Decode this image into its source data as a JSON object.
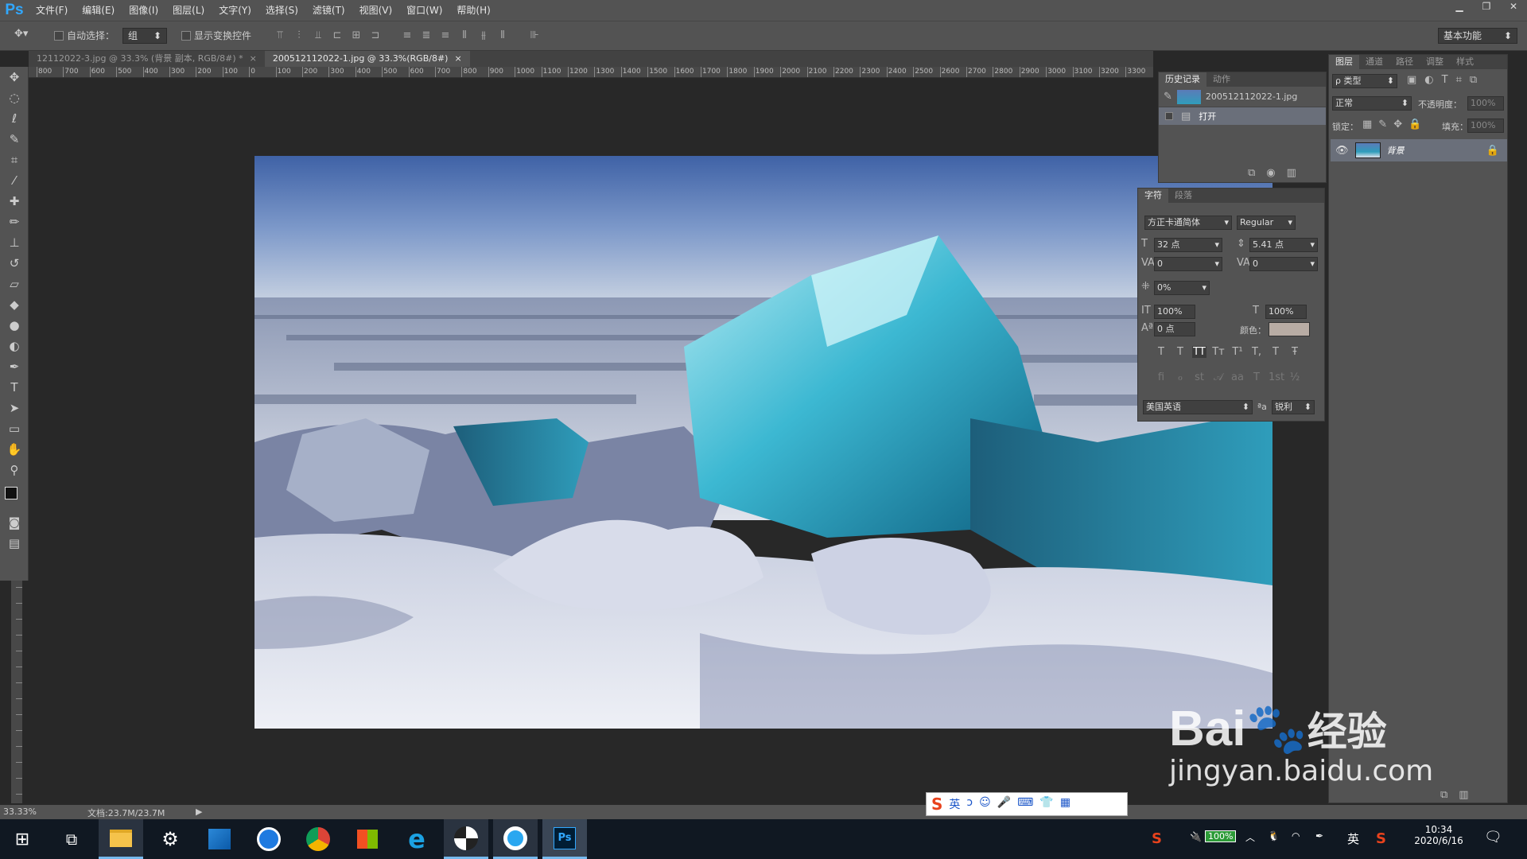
{
  "app": {
    "logo": "Ps"
  },
  "menu": [
    "文件(F)",
    "编辑(E)",
    "图像(I)",
    "图层(L)",
    "文字(Y)",
    "选择(S)",
    "滤镜(T)",
    "视图(V)",
    "窗口(W)",
    "帮助(H)"
  ],
  "window_controls": {
    "minimize": "▁",
    "restore": "❐",
    "close": "✕"
  },
  "options": {
    "auto_select_label": "自动选择：",
    "auto_select_value": "组",
    "show_transform_label": "显示变换控件",
    "workspace": "基本功能"
  },
  "tabs": [
    {
      "label": "12112022-3.jpg @ 33.3% (背景 副本, RGB/8#) *",
      "close": "×"
    },
    {
      "label": "200512112022-1.jpg @ 33.3%(RGB/8#)",
      "close": "×"
    }
  ],
  "ruler_h": [
    "800",
    "700",
    "600",
    "500",
    "400",
    "300",
    "200",
    "100",
    "0",
    "100",
    "200",
    "300",
    "400",
    "500",
    "600",
    "700",
    "800",
    "900",
    "1000",
    "1100",
    "1200",
    "1300",
    "1400",
    "1500",
    "1600",
    "1700",
    "1800",
    "1900",
    "2000",
    "2100",
    "2200",
    "2300",
    "2400",
    "2500",
    "2600",
    "2700",
    "2800",
    "2900",
    "3000",
    "3100",
    "3200",
    "3300"
  ],
  "status": {
    "zoom": "33.33%",
    "doc": "文档:23.7M/23.7M"
  },
  "history_panel": {
    "tabs": [
      "历史记录",
      "动作"
    ],
    "snapshot": "200512112022-1.jpg",
    "items": [
      "打开"
    ]
  },
  "char_panel": {
    "tabs": [
      "字符",
      "段落"
    ],
    "font_family": "方正卡通简体",
    "font_style": "Regular",
    "size": "32 点",
    "leading": "5.41 点",
    "kerning": "0",
    "tracking": "0",
    "tsume": "0%",
    "v_scale": "100%",
    "h_scale": "100%",
    "baseline": "0 点",
    "color_label": "颜色：",
    "color": "#b8aca4",
    "type_styles": [
      "T",
      "T",
      "TT",
      "Tт",
      "T¹",
      "T,",
      "T",
      "Ŧ"
    ],
    "opentype": [
      "ﬁ",
      "ℴ",
      "st",
      "𝒜",
      "aa",
      "T",
      "1st",
      "½"
    ],
    "language": "美国英语",
    "aa_label": "ªa",
    "aa": "锐利"
  },
  "layers_panel": {
    "tabs": [
      "图层",
      "通道",
      "路径",
      "调整",
      "样式"
    ],
    "filter": "ρ 类型",
    "blend": "正常",
    "opacity_label": "不透明度：",
    "opacity": "100%",
    "lock_label": "锁定：",
    "fill_label": "填充：",
    "fill": "100%",
    "layers": [
      {
        "name": "背景"
      }
    ]
  },
  "taskbar": {
    "battery": "100%",
    "lang": "英",
    "time": "10:34",
    "date": "2020/6/16",
    "ime": [
      "英",
      "ɔ",
      "☺",
      "🎤",
      "⌨",
      "👕",
      "▦"
    ]
  },
  "watermark": {
    "brand": "Bai",
    "cn": "经验",
    "url": "jingyan.baidu.com"
  }
}
